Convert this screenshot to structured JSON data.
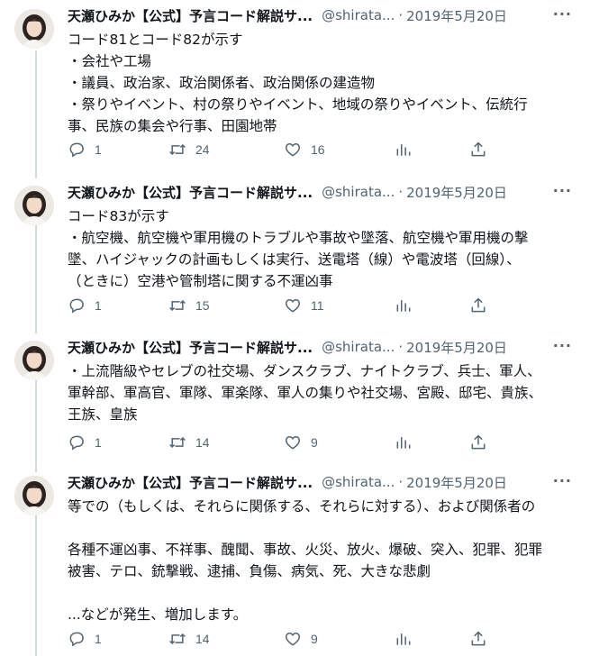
{
  "author": {
    "name": "天瀬ひみか【公式】予言コード解説サ...",
    "handle": "@shirata...",
    "date": "2019年5月20日",
    "separator": "·"
  },
  "tweets": [
    {
      "lines": [
        "コード81とコード82が示す",
        "・会社や工場",
        "・議員、政治家、政治関係者、政治関係の建造物",
        "・祭りやイベント、村の祭りやイベント、地域の祭りやイベント、伝統行",
        "事、民族の集会や行事、田園地帯"
      ],
      "replies": "1",
      "retweets": "24",
      "likes": "16"
    },
    {
      "lines": [
        "コード83が示す",
        "・航空機、航空機や軍用機のトラブルや事故や墜落、航空機や軍用機の撃",
        "墜、ハイジャックの計画もしくは実行、送電塔（線）や電波塔（回線）、",
        "（ときに）空港や管制塔に関する不運凶事"
      ],
      "replies": "1",
      "retweets": "15",
      "likes": "11"
    },
    {
      "lines": [
        "・上流階級やセレブの社交場、ダンスクラブ、ナイトクラブ、兵士、軍人、",
        "軍幹部、軍高官、軍隊、軍楽隊、軍人の集りや社交場、宮殿、邸宅、貴族、",
        "王族、皇族"
      ],
      "replies": "1",
      "retweets": "14",
      "likes": "9"
    },
    {
      "lines": [
        "等での（もしくは、それらに関係する、それらに対する）、および関係者の",
        "",
        "各種不運凶事、不祥事、醜聞、事故、火災、放火、爆破、突入、犯罪、犯罪",
        "被害、テロ、銃撃戦、逮捕、負傷、病気、死、大きな悲劇",
        "",
        "...などが発生、増加します。"
      ],
      "replies": "1",
      "retweets": "14",
      "likes": "9"
    }
  ],
  "icons": {
    "reply": "reply-icon",
    "retweet": "retweet-icon",
    "like": "heart-icon",
    "analytics": "analytics-icon",
    "share": "share-icon",
    "more": "more-options-icon"
  },
  "colors": {
    "text": "#0f1419",
    "secondary": "#536471",
    "thread_line": "#cfd9de"
  }
}
